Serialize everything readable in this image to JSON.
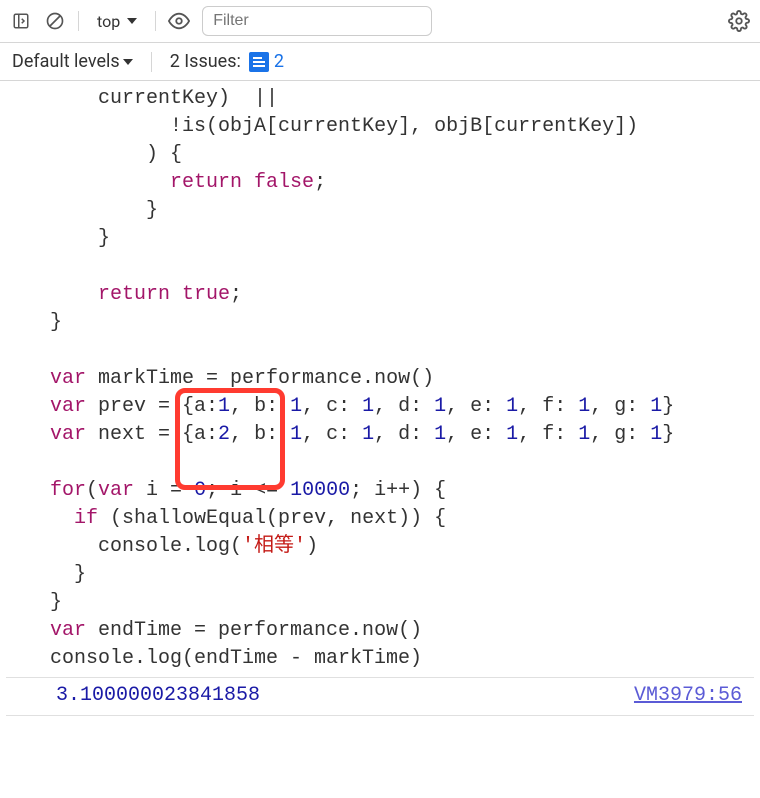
{
  "toolbar": {
    "context": "top",
    "filter_placeholder": "Filter"
  },
  "toolbar2": {
    "levels_label": "Default levels",
    "issues_label": "2 Issues:",
    "issues_count": "2"
  },
  "code": {
    "l1a": "    currentKey)  ||",
    "l2_indent": "          !is(objA[currentKey], objB[currentKey])",
    "l3": "        ) {",
    "l4_ret": "          return",
    "l4_false": " false",
    "l4_semi": ";",
    "l5": "        }",
    "l6": "    }",
    "blank1": "",
    "l7_ret": "    return",
    "l7_true": " true",
    "l7_semi": ";",
    "l8": "}",
    "blank2": "",
    "l9_var": "var",
    "l9_rest": " markTime = performance.now()",
    "l10_var": "var",
    "l10_p1": " prev = {a:",
    "l10_n1": "1",
    "l10_p2": ", b: ",
    "l10_n2": "1",
    "l10_p3": ", c: ",
    "l10_n3": "1",
    "l10_p4": ", d: ",
    "l10_n4": "1",
    "l10_p5": ", e: ",
    "l10_n5": "1",
    "l10_p6": ", f: ",
    "l10_n6": "1",
    "l10_p7": ", g: ",
    "l10_n7": "1",
    "l10_p8": "}",
    "l11_var": "var",
    "l11_p1": " next = {a:",
    "l11_n1": "2",
    "l11_p2": ", b: ",
    "l11_n2": "1",
    "l11_p3": ", c: ",
    "l11_n3": "1",
    "l11_p4": ", d: ",
    "l11_n4": "1",
    "l11_p5": ", e: ",
    "l11_n5": "1",
    "l11_p6": ", f: ",
    "l11_n6": "1",
    "l11_p7": ", g: ",
    "l11_n7": "1",
    "l11_p8": "}",
    "blank3": "",
    "l12_for": "for",
    "l12_a": "(",
    "l12_var": "var",
    "l12_b": " i = ",
    "l12_n0": "0",
    "l12_c": "; i <= ",
    "l12_n1": "10000",
    "l12_d": "; i++) {",
    "l13_if": "  if",
    "l13_rest": " (shallowEqual(prev, next)) {",
    "l14_a": "    console.log(",
    "l14_str": "'相等'",
    "l14_b": ")",
    "l15": "  }",
    "l16": "}",
    "l17_var": "var",
    "l17_rest": " endTime = performance.now()",
    "l18": "console.log(endTime - markTime)"
  },
  "output": {
    "value": "3.100000023841858",
    "source": "VM3979:56"
  },
  "highlight": {
    "top_px": "388",
    "left_px": "175",
    "width_px": "110",
    "height_px": "102"
  }
}
